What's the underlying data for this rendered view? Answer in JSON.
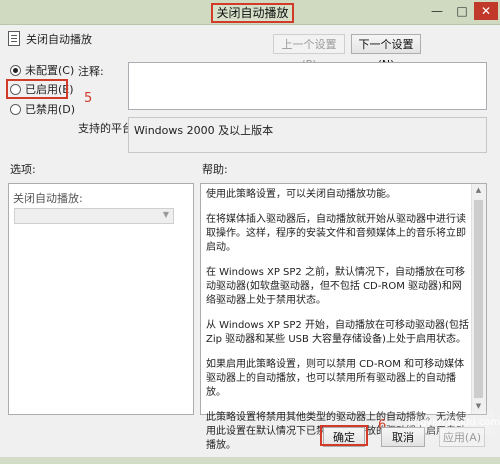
{
  "window": {
    "title": "关闭自动播放",
    "min_symbol": "—",
    "max_symbol": "□",
    "close_symbol": "✕"
  },
  "setting": {
    "name": "关闭自动播放",
    "prev_label": "上一个设置(P)",
    "next_label": "下一个设置(N)"
  },
  "radios": [
    {
      "label": "未配置(C)",
      "checked": true
    },
    {
      "label": "已启用(E)",
      "checked": false
    },
    {
      "label": "已禁用(D)",
      "checked": false
    }
  ],
  "annotations": {
    "step_number": "5",
    "step_six": "6"
  },
  "comment": {
    "label": "注释:",
    "value": ""
  },
  "platform": {
    "label": "支持的平台:",
    "value": "Windows 2000 及以上版本"
  },
  "options": {
    "header": "选项:",
    "caption": "关闭自动播放:",
    "combo_value": ""
  },
  "help": {
    "header": "帮助:",
    "paragraphs": [
      "使用此策略设置，可以关闭自动播放功能。",
      "在将媒体插入驱动器后，自动播放就开始从驱动器中进行读取操作。这样，程序的安装文件和音频媒体上的音乐将立即启动。",
      "在 Windows XP SP2 之前，默认情况下，自动播放在可移动驱动器(如软盘驱动器，但不包括 CD-ROM 驱动器)和网络驱动器上处于禁用状态。",
      "从 Windows XP SP2 开始，自动播放在可移动驱动器(包括 Zip 驱动器和某些 USB 大容量存储设备)上处于启用状态。",
      "如果启用此策略设置，则可以禁用 CD-ROM 和可移动媒体驱动器上的自动播放，也可以禁用所有驱动器上的自动播放。",
      "此策略设置将禁用其他类型的驱动器上的自动播放。无法使用此设置在默认情况下已禁用自动播放的驱动器上启用自动播放。"
    ]
  },
  "buttons": {
    "ok": "确定",
    "cancel": "取消",
    "apply": "应用(A)"
  },
  "watermark": {
    "text": "jingyan.baidu.com"
  },
  "colors": {
    "annotation_red": "#d23a2a",
    "titlebar": "#cfdac1"
  }
}
